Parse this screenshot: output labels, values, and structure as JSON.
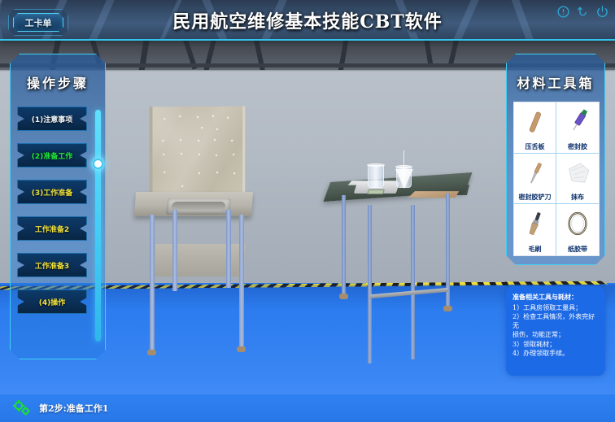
{
  "header": {
    "title": "民用航空维修基本技能CBT软件",
    "workorder_button": "工卡单",
    "icons": [
      {
        "name": "help-icon",
        "label": "帮助"
      },
      {
        "name": "undo-icon",
        "label": "返回"
      },
      {
        "name": "power-icon",
        "label": "退出"
      }
    ]
  },
  "left_panel": {
    "title": "操作步骤",
    "steps": [
      {
        "label": "(1)注意事项",
        "state": "done"
      },
      {
        "label": "(2)准备工作",
        "state": "active"
      },
      {
        "label": "(3)工作准备",
        "state": "pending"
      },
      {
        "label": "工作准备2",
        "state": "pending"
      },
      {
        "label": "工作准备3",
        "state": "pending"
      },
      {
        "label": "(4)操作",
        "state": "pending"
      }
    ]
  },
  "right_panel": {
    "title": "材料工具箱",
    "tools": [
      {
        "label": "压舌板",
        "icon": "tongue-depressor-icon"
      },
      {
        "label": "密封胶",
        "icon": "sealant-syringe-icon"
      },
      {
        "label": "密封胶铲刀",
        "icon": "sealant-spatula-icon"
      },
      {
        "label": "抹布",
        "icon": "cloth-rag-icon"
      },
      {
        "label": "毛刷",
        "icon": "brush-icon"
      },
      {
        "label": "纸胶带",
        "icon": "masking-tape-icon"
      }
    ]
  },
  "info_panel": {
    "heading": "准备相关工具与耗材：",
    "lines": [
      "1）工具房领取工量具；",
      "2）检查工具情况，外表完好无",
      "损伤，功能正常；",
      "3）领取耗材；",
      "4）办理领取手续。"
    ]
  },
  "statusbar": {
    "text": "第2步:准备工作1",
    "icon": "gears-icon"
  },
  "colors": {
    "accent_cyan": "#3fd0f2",
    "floor_blue": "#2f7ef0",
    "active_green": "#22e83a",
    "pending_yellow": "#f2e23a",
    "panel_blue": "#1d6ae6",
    "header_dark": "#37506e"
  }
}
